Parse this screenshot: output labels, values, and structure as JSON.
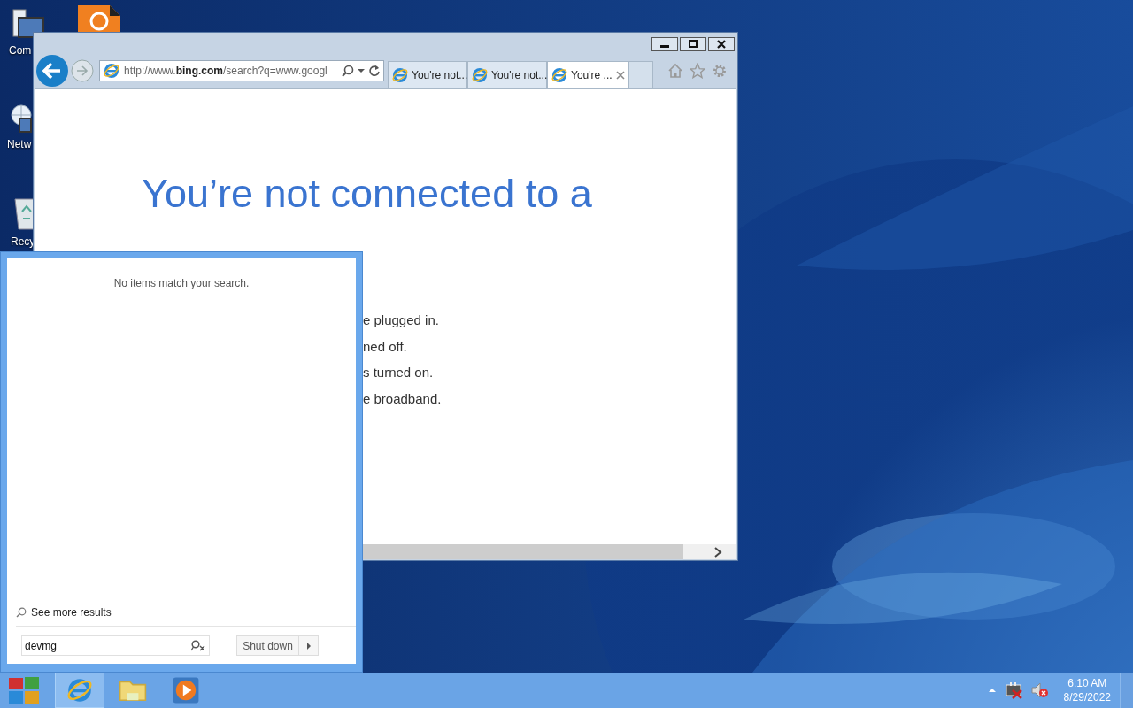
{
  "desktop_icons": [
    {
      "kind": "computer",
      "label": "Com"
    },
    {
      "kind": "network",
      "label": "Netw"
    },
    {
      "kind": "recycle",
      "label": "Recy"
    },
    {
      "kind": "app"
    }
  ],
  "browser": {
    "address": "http://www.**bing.com**/search?q=www.googl",
    "tabs": [
      {
        "title": "You're not...",
        "selected": false
      },
      {
        "title": "You're not...",
        "selected": false
      },
      {
        "title": "You're ...",
        "selected": true
      }
    ],
    "heading": "You’re not connected to a",
    "lines": [
      "e plugged in.",
      "ned off.",
      "s turned on.",
      "e broadband."
    ]
  },
  "start_menu": {
    "message": "No items match your search.",
    "see_more": "See more results",
    "search": {
      "value": "devmg"
    },
    "shutdown": "Shut down"
  },
  "taskbar": {
    "apps": [
      {
        "kind": "browser",
        "selected": true
      },
      {
        "kind": "folder",
        "selected": false
      },
      {
        "kind": "media",
        "selected": false
      }
    ],
    "clock": {
      "time": "6:10 AM",
      "date": "8/29/2022"
    }
  }
}
